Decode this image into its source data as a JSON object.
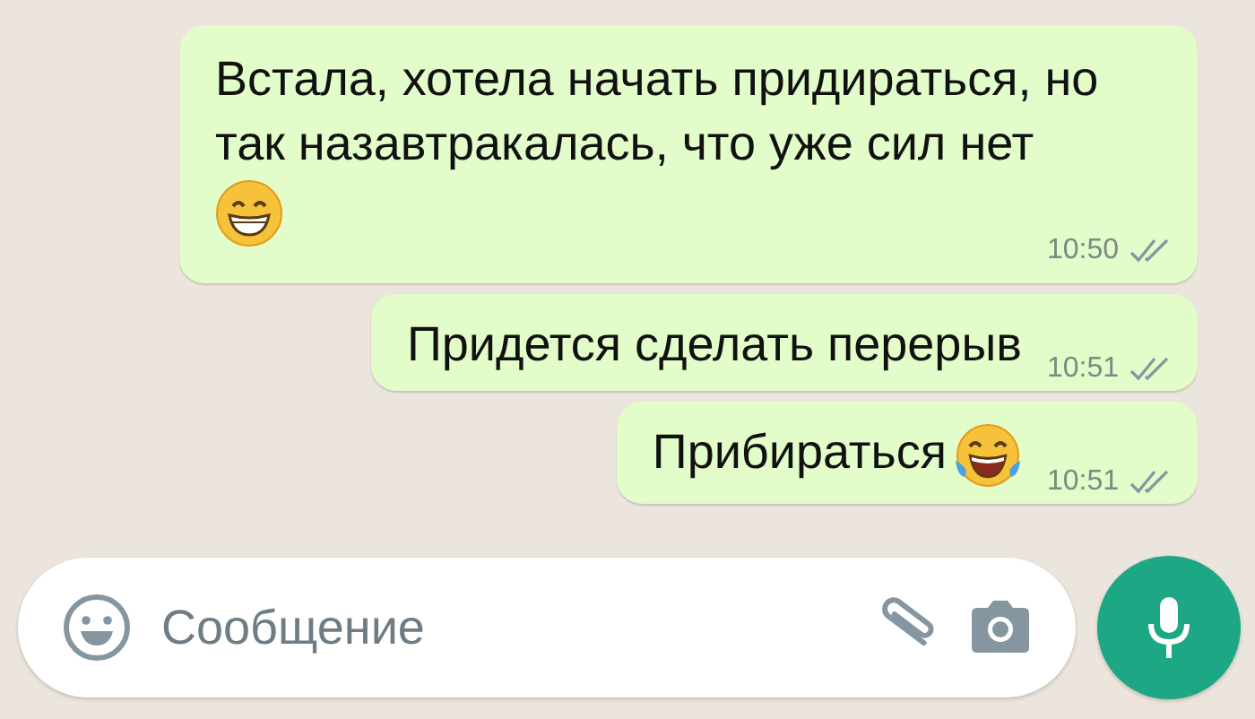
{
  "messages": [
    {
      "kind": "grinning",
      "text": "Встала, хотела начать придираться, но так назавтракалась, что уже сил нет",
      "time": "10:50",
      "read": false
    },
    {
      "kind": "plain",
      "text": "Придется сделать перерыв",
      "time": "10:51",
      "read": false
    },
    {
      "kind": "laughing",
      "text": "Прибираться",
      "time": "10:51",
      "read": false
    }
  ],
  "composer": {
    "placeholder": "Сообщение"
  }
}
